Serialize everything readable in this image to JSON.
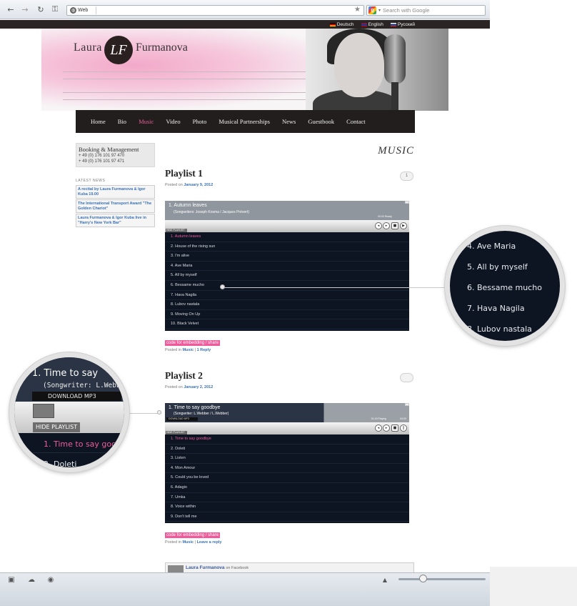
{
  "browser": {
    "url_chip": "Web",
    "search_placeholder": "Search with Google",
    "back_icon": "back-arrow-icon",
    "forward_icon": "forward-arrow-icon",
    "reload_icon": "reload-icon",
    "key_icon": "key-icon"
  },
  "site": {
    "languages": [
      "Deutsch",
      "English",
      "Русский"
    ],
    "logo_first": "Laura",
    "logo_monogram": "LF",
    "logo_last": "Furmanova",
    "nav": [
      "Home",
      "Bio",
      "Music",
      "Video",
      "Photo",
      "Musical Partnerships",
      "News",
      "Guestbook",
      "Contact"
    ],
    "nav_active": "Music",
    "accent": "#e75b93"
  },
  "sidebar": {
    "booking_title": "Booking & Management",
    "phones": [
      "+ 49 (0) 176 101 97 470",
      "+ 49 (0) 176 101 97 471"
    ],
    "latest_news_heading": "LATEST NEWS",
    "news": [
      "A recital by Laura Furmanova & Igor Kuba 19.00",
      "The International Transport Award \"The Golden Chariot\"",
      "Laura Furmanova & Igor Kuba live in \"Harry's New York Bar\""
    ]
  },
  "main": {
    "section_heading": "MUSIC",
    "playlist1": {
      "title": "Playlist 1",
      "posted_prefix": "Posted on",
      "date": "January 9, 2012",
      "comments": "1",
      "now_playing": "1. Autumn leaves",
      "songwriters": "(Songwriters: Joseph Kosma / Jacques Prévert)",
      "status": "00:00  Ready",
      "hide_playlist": "HIDE PLAYLIST",
      "tracks": [
        "1. Autumn leaves",
        "2. House of the rising sun",
        "3. I'm alive",
        "4. Ave Maria",
        "5. All by myself",
        "6. Bessame mucho",
        "7. Hava Nagila",
        "8. Lubov nastala",
        "9. Moving On Up",
        "10. Black Velvet"
      ],
      "embed_label": "code for embedding / share",
      "posted_in": "Posted in",
      "category": "Music",
      "reply": "1 Reply"
    },
    "playlist2": {
      "title": "Playlist 2",
      "posted_prefix": "Posted on",
      "date": "January 2, 2012",
      "now_playing": "1. Time to say goodbye",
      "songwriters": "(Songwriter: L.Webber / L.Webber)",
      "download": "DOWNLOAD MP3",
      "status": "01:43  Playing",
      "duration": "04:03",
      "hide_playlist": "HIDE PLAYLIST",
      "tracks": [
        "1. Time to say goodbye",
        "2. Doleti",
        "3. Listen",
        "4. Mon Amour",
        "5. Could you be loved",
        "6. Adagio",
        "7. Umka",
        "8. Voice within",
        "9. Don't tell me"
      ],
      "embed_label": "code for embedding / share",
      "posted_in": "Posted in",
      "category": "Music",
      "reply": "Leave a reply"
    },
    "facebook": {
      "name": "Laura Furmanova",
      "suffix": "on Facebook"
    }
  },
  "magnifier_right": {
    "items": [
      "4. Ave Maria",
      "5. All by myself",
      "6. Bessame mucho",
      "7. Hava Nagila",
      "8. Lubov nastala"
    ]
  },
  "magnifier_left": {
    "title_fragment": "1. Time to say",
    "songwriter_fragment": "(Songwriter: L.Webber",
    "download": "DOWNLOAD MP3",
    "hide_playlist": "HIDE PLAYLIST",
    "track1_fragment": "1. Time to say goo",
    "track2_fragment": "2. Doleti"
  }
}
